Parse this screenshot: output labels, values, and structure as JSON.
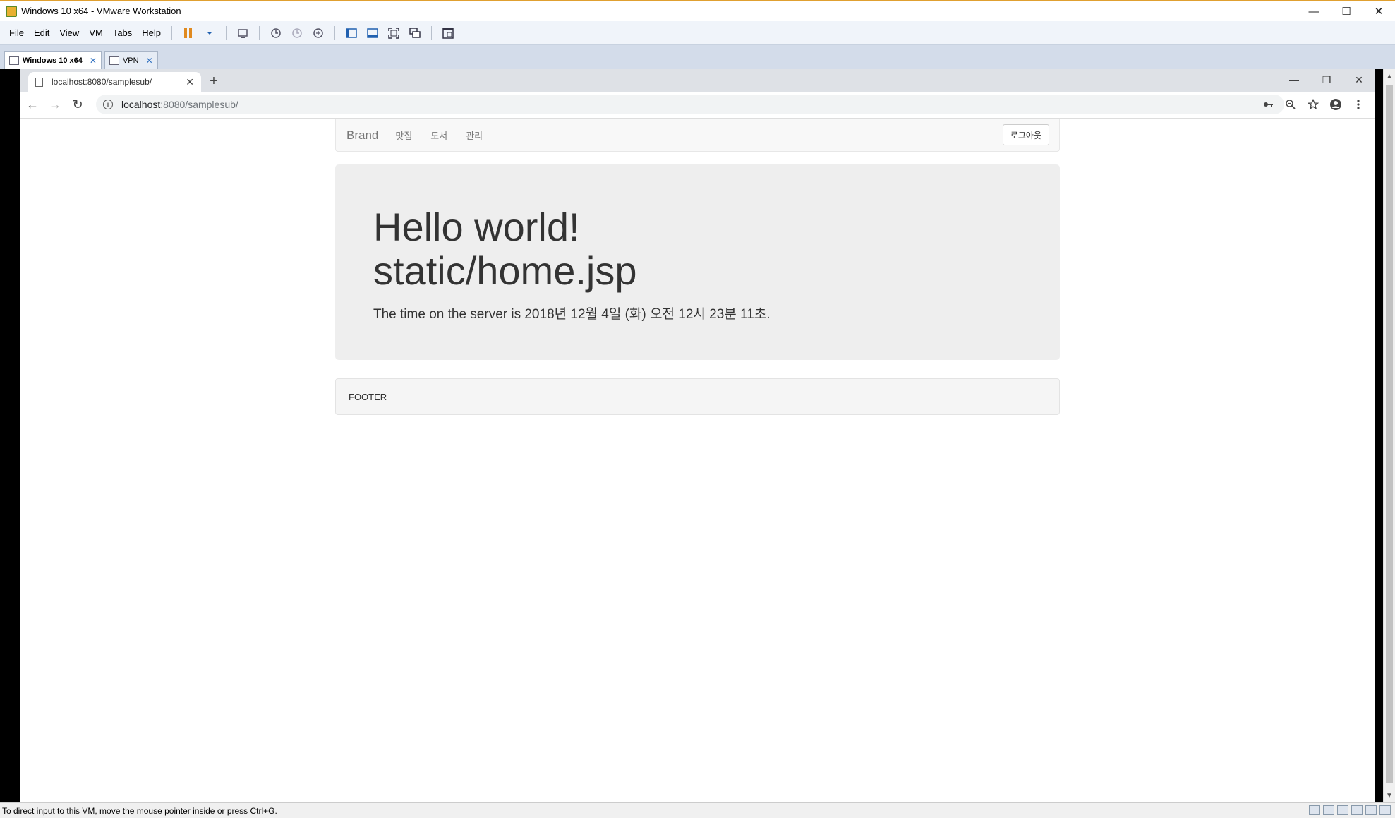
{
  "vm_window": {
    "title": "Windows 10 x64 - VMware Workstation",
    "controls": {
      "minimize": "—",
      "maximize": "☐",
      "close": "✕"
    }
  },
  "vm_menu": {
    "items": [
      "File",
      "Edit",
      "View",
      "VM",
      "Tabs",
      "Help"
    ]
  },
  "vm_tabs": [
    {
      "label": "Windows 10 x64",
      "close": "✕"
    },
    {
      "label": "VPN",
      "close": "✕"
    }
  ],
  "chrome": {
    "tab_title": "localhost:8080/samplesub/",
    "tab_close": "✕",
    "new_tab": "+",
    "controls": {
      "minimize": "—",
      "restore": "❐",
      "close": "✕"
    },
    "nav": {
      "back": "←",
      "forward": "→",
      "reload": "↻"
    },
    "url_host": "localhost",
    "url_path": ":8080/samplesub/",
    "right_icons": [
      "key-icon",
      "zoom-icon",
      "star-icon",
      "account-icon",
      "menu-icon"
    ]
  },
  "page": {
    "navbar": {
      "brand": "Brand",
      "links": [
        "맛집",
        "도서",
        "관리"
      ],
      "logout": "로그아웃"
    },
    "jumbotron": {
      "heading_line1": "Hello world!",
      "heading_line2": "static/home.jsp",
      "time_text": "The time on the server is 2018년 12월 4일 (화) 오전 12시 23분 11초."
    },
    "footer": "FOOTER"
  },
  "status_bar": {
    "text": "To direct input to this VM, move the mouse pointer inside or press Ctrl+G."
  }
}
